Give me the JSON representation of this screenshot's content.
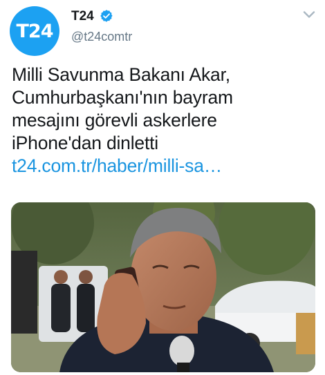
{
  "colors": {
    "brand": "#1ca1f2",
    "link": "#1b95e0",
    "text": "#14171a",
    "secondary": "#657786",
    "verified": "#1da1f2",
    "chevron": "#aab8c2"
  },
  "tweet": {
    "avatar_text": "T24",
    "author_name": "T24",
    "author_handle": "@t24comtr",
    "verified_icon": "verified-badge-icon",
    "menu_icon": "chevron-down-icon",
    "text_lines": [
      "Milli Savunma Bakanı Akar,",
      "Cumhurbaşkanı'nın bayram",
      "mesajını görevli askerlere",
      "iPhone'dan dinletti"
    ],
    "link_text": "t24.com.tr/haber/milli-sa…",
    "media": {
      "type": "photo"
    }
  }
}
